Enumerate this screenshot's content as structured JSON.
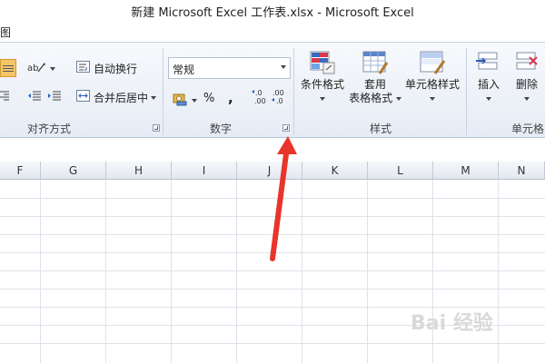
{
  "title": "新建 Microsoft Excel 工作表.xlsx  -  Microsoft Excel",
  "menu": {
    "partial_tab": "图"
  },
  "ribbon": {
    "alignment": {
      "wrap_text": "自动换行",
      "merge_center": "合并后居中",
      "group_label": "对齐方式"
    },
    "number": {
      "format_value": "常规",
      "percent": "%",
      "comma": ",",
      "inc_decimal": "←.0\n.00",
      "dec_decimal": ".00\n→.0",
      "group_label": "数字"
    },
    "styles": {
      "conditional": "条件格式",
      "table_format": [
        "套用",
        "表格格式"
      ],
      "cell_styles": "单元格样式",
      "group_label": "样式"
    },
    "cells": {
      "insert": "插入",
      "delete": "删除",
      "group_label": "单元格"
    }
  },
  "columns": [
    "F",
    "G",
    "H",
    "I",
    "J",
    "K",
    "L",
    "M",
    "N"
  ],
  "colors": {
    "accent_selected": "#f5c56a",
    "arrow": "#e8342a",
    "ribbon_bg": "#e6ecf5"
  },
  "watermark": "Bai 经验"
}
